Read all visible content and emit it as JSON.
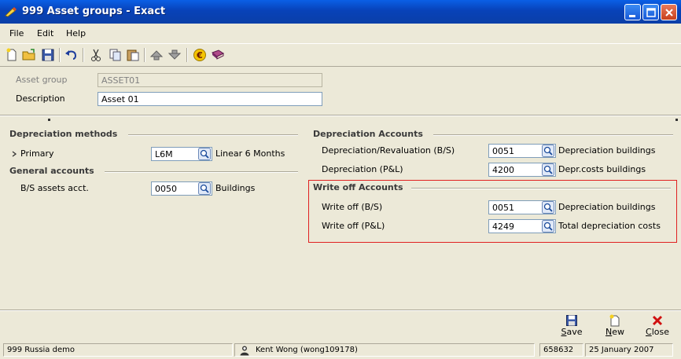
{
  "window": {
    "title": "999 Asset groups - Exact"
  },
  "menu": [
    "File",
    "Edit",
    "Help"
  ],
  "header": {
    "asset_group_label": "Asset group",
    "asset_group_value": "ASSET01",
    "description_label": "Description",
    "description_value": "Asset 01"
  },
  "depreciation_methods": {
    "title": "Depreciation methods",
    "primary_label": "Primary",
    "primary_code": "L6M",
    "primary_desc": "Linear 6 Months"
  },
  "general_accounts": {
    "title": "General accounts",
    "bs_label": "B/S assets acct.",
    "bs_code": "0050",
    "bs_desc": "Buildings"
  },
  "depreciation_accounts": {
    "title": "Depreciation Accounts",
    "reval_label": "Depreciation/Revaluation (B/S)",
    "reval_code": "0051",
    "reval_desc": "Depreciation buildings",
    "pl_label": "Depreciation (P&L)",
    "pl_code": "4200",
    "pl_desc": "Depr.costs buildings"
  },
  "write_off_accounts": {
    "title": "Write off Accounts",
    "bs_label": "Write off (B/S)",
    "bs_code": "0051",
    "bs_desc": "Depreciation buildings",
    "pl_label": "Write off (P&L)",
    "pl_code": "4249",
    "pl_desc": "Total depreciation costs"
  },
  "buttons": {
    "save_pre": "",
    "save_u": "S",
    "save_post": "ave",
    "new_pre": "",
    "new_u": "N",
    "new_post": "ew",
    "close_pre": "",
    "close_u": "C",
    "close_post": "lose"
  },
  "status": {
    "company": "999 Russia demo",
    "user": "Kent Wong (wong109178)",
    "number": "658632",
    "date": "25 January 2007"
  },
  "colors": {
    "highlight_border": "#e02020",
    "titlebar": "#0a5fe6"
  }
}
